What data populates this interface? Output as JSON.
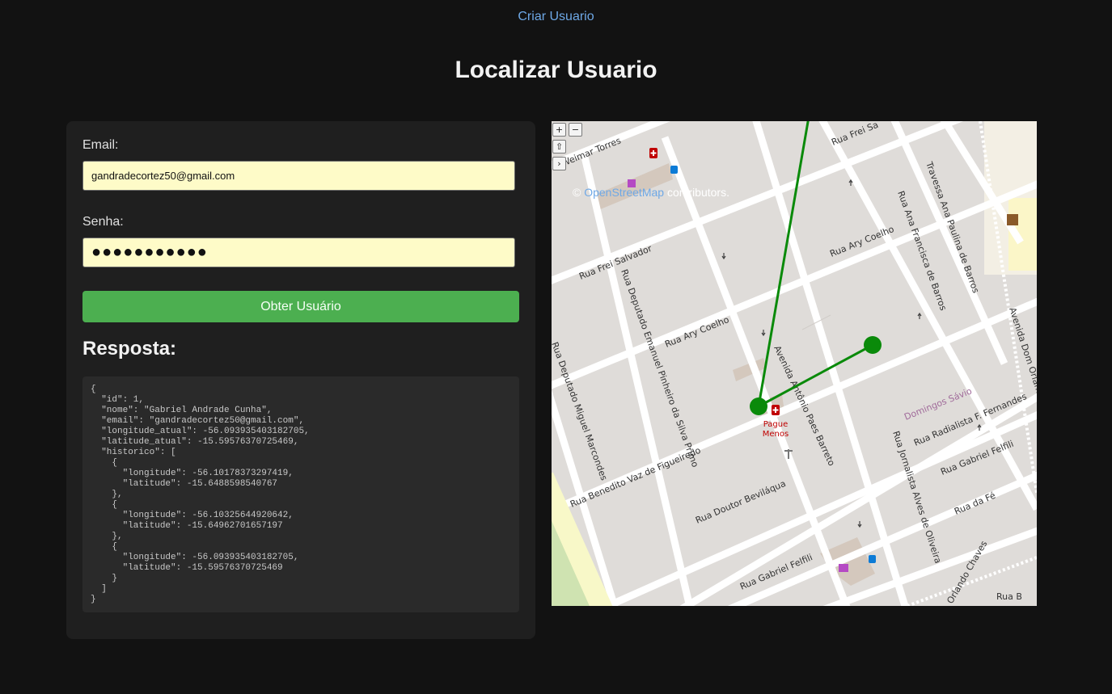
{
  "nav": {
    "create_user_link": "Criar Usuario"
  },
  "page": {
    "title": "Localizar Usuario"
  },
  "form": {
    "email_label": "Email:",
    "email_value": "gandradecortez50@gmail.com",
    "password_label": "Senha:",
    "password_value": "●●●●●●●●●●●",
    "submit_label": "Obter Usuário"
  },
  "response": {
    "title": "Resposta:",
    "json": "{\n  \"id\": 1,\n  \"nome\": \"Gabriel Andrade Cunha\",\n  \"email\": \"gandradecortez50@gmail.com\",\n  \"longitude_atual\": -56.093935403182705,\n  \"latitude_atual\": -15.59576370725469,\n  \"historico\": [\n    {\n      \"longitude\": -56.10178373297419,\n      \"latitude\": -15.6488598540767\n    },\n    {\n      \"longitude\": -56.10325644920642,\n      \"latitude\": -15.64962701657197\n    },\n    {\n      \"longitude\": -56.093935403182705,\n      \"latitude\": -15.59576370725469\n    }\n  ]\n}"
  },
  "map": {
    "zoom_in": "+",
    "zoom_out": "−",
    "rotate_icon": "⇧",
    "expand_icon": "›",
    "attribution_prefix": "© ",
    "attribution_link": "OpenStreetMap",
    "attribution_suffix": " contributors.",
    "route_color": "#0a8a0a",
    "poi_pharmacy_line1": "Pague",
    "poi_pharmacy_line2": "Menos",
    "streets": {
      "s1": "Rua Frei Salvador",
      "s2": "Rua Deputado Emanuel Pinheiro da Silva Primo",
      "s3": "Rua Ary Coelho",
      "s4": "Rua Ary Coelho",
      "s5": "Avenida Antônio Paes Barreto",
      "s6": "Rua Benedito Vaz de Figueiredo",
      "s7": "Rua Doutor Beviláqua",
      "s8": "Rua Gabriel Felfili",
      "s9": "Rua Gabriel Felfili",
      "s10": "Rua Jornalista Alves de Oliveira",
      "s11": "Rua Radialista F. Fernandes",
      "s12": "Rua da Fé",
      "s13": "Avenida Dom Orlando Chaves",
      "s14": "Travessa Ana Paulina de Barros",
      "s15": "Rua Ana Francisca de Barros",
      "s16": "Rua Deputado Miguel Marcondes",
      "s17": "Domingos Sávio",
      "s18": "Rua B",
      "s19": "Weimar Torres",
      "s20": "Rua Frei Sa",
      "s21": "Orlando Chaves"
    }
  }
}
